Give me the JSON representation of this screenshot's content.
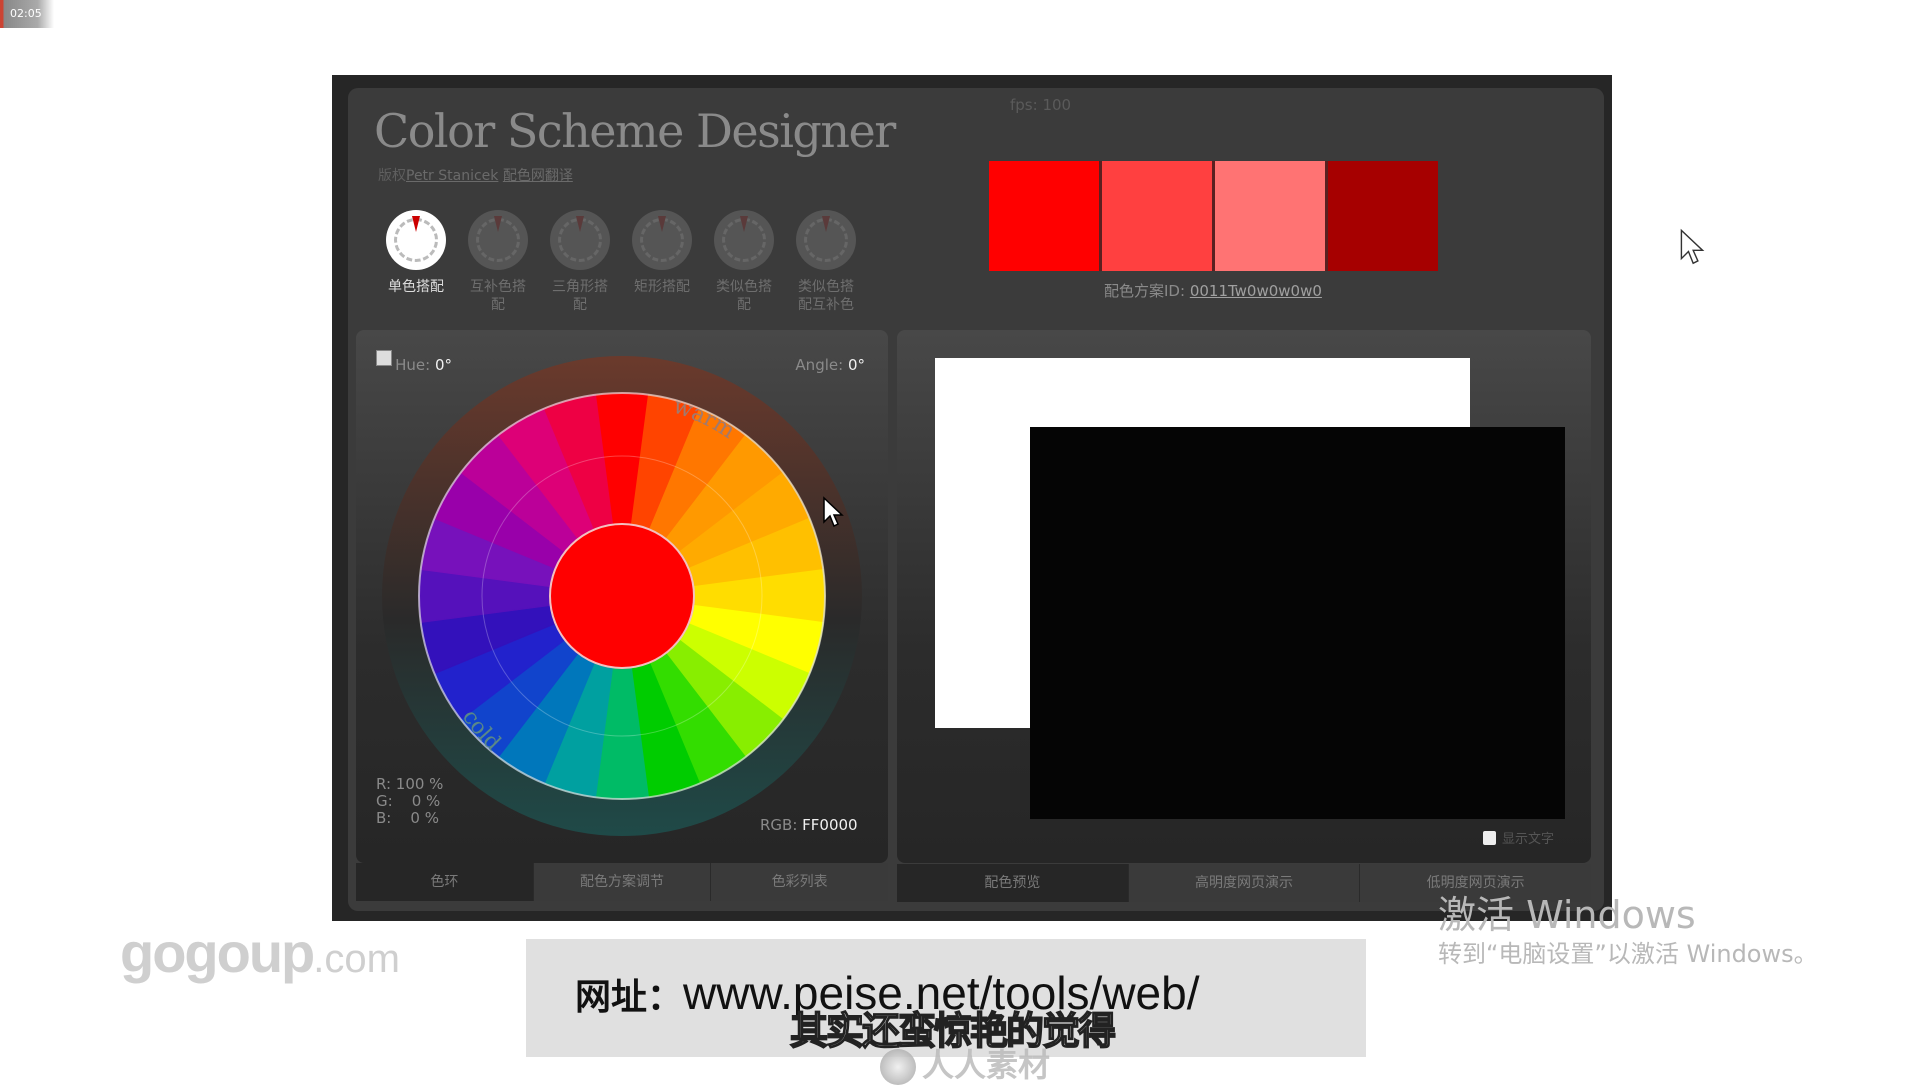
{
  "video": {
    "timestamp": "02:05"
  },
  "app": {
    "title": "Color Scheme Designer",
    "credit_prefix": "版权",
    "credit_author": "Petr Stanicek",
    "credit_translation": "配色网翻译",
    "fps": "fps: 100"
  },
  "schemes": [
    {
      "label": "单色搭配",
      "icon": "mono-scheme-icon",
      "active": true
    },
    {
      "label": "互补色搭配",
      "icon": "complement-scheme-icon",
      "active": false
    },
    {
      "label": "三角形搭配",
      "icon": "triad-scheme-icon",
      "active": false
    },
    {
      "label": "矩形搭配",
      "icon": "tetrad-scheme-icon",
      "active": false
    },
    {
      "label": "类似色搭配",
      "icon": "analogic-scheme-icon",
      "active": false
    },
    {
      "label": "类似色搭配互补色",
      "icon": "accented-analogic-scheme-icon",
      "active": false
    }
  ],
  "palette": {
    "colors": [
      "#FF0000",
      "#FF4040",
      "#FF7373",
      "#A60000"
    ],
    "id_label": "配色方案ID:",
    "id_value": "0011Tw0w0w0w0"
  },
  "wheel": {
    "hue_label": "Hue:",
    "hue_value": "0°",
    "angle_label": "Angle:",
    "angle_value": "0°",
    "warm_label": "warm",
    "cold_label": "cold",
    "selected_color": "#FF0000",
    "rgb_pct": "R: 100 %\nG:    0 %\nB:    0 %",
    "rgb_label": "RGB:",
    "rgb_value": "FF0000"
  },
  "left_tabs": [
    {
      "label": "色环",
      "active": true
    },
    {
      "label": "配色方案调节",
      "active": false
    },
    {
      "label": "色彩列表",
      "active": false
    }
  ],
  "preview": {
    "show_text_label": "显示文字",
    "show_text_checked": false
  },
  "right_tabs": [
    {
      "label": "配色预览",
      "active": true
    },
    {
      "label": "高明度网页演示",
      "active": false
    },
    {
      "label": "低明度网页演示",
      "active": false
    }
  ],
  "overlay": {
    "logo_main": "gogoup",
    "logo_suffix": ".com",
    "url_label": "网址：",
    "url_value": "www.peise.net/tools/web/",
    "subtitle": "其实还蛮惊艳的觉得",
    "watermark": "人人素材",
    "activate_title": "激活 Windows",
    "activate_sub": "转到“电脑设置”以激活 Windows。"
  }
}
